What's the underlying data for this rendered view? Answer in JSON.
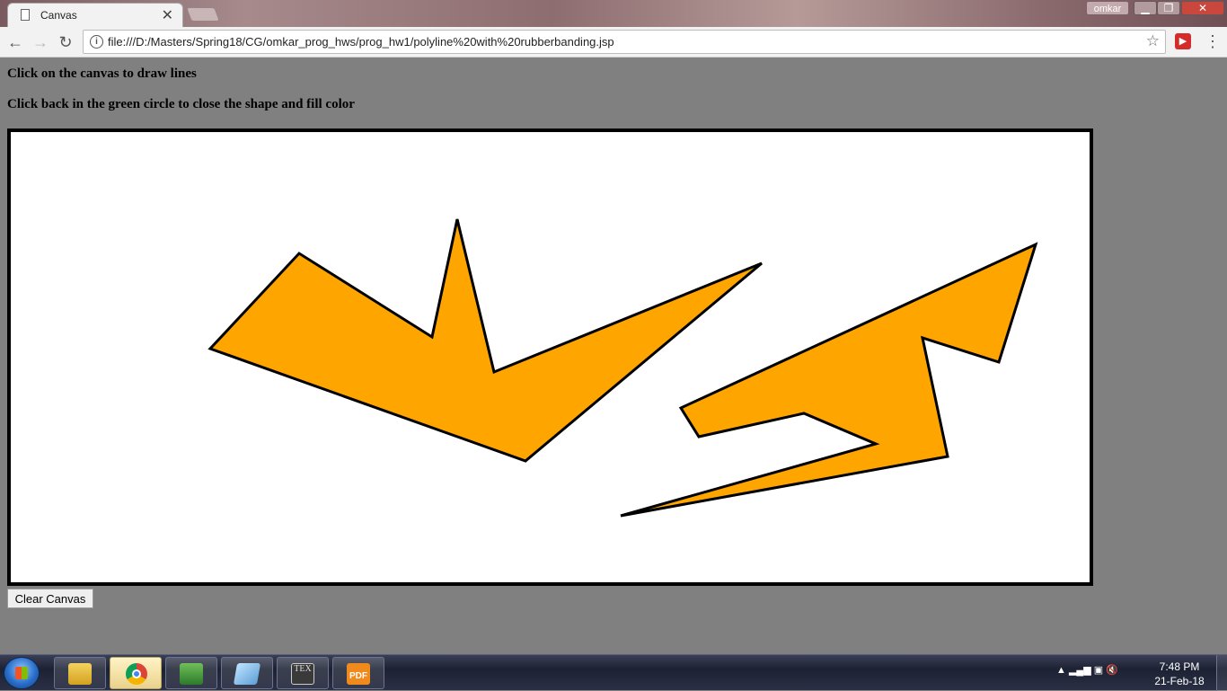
{
  "tab": {
    "title": "Canvas",
    "close_glyph": "✕"
  },
  "window": {
    "user": "omkar",
    "min": "▁",
    "max": "❐",
    "close": "✕"
  },
  "toolbar": {
    "back": "←",
    "forward": "→",
    "reload": "↻",
    "url": "file:///D:/Masters/Spring18/CG/omkar_prog_hws/prog_hw1/polyline%20with%20rubberbanding.jsp",
    "info": "i",
    "star": "☆",
    "menu": "⋮",
    "ext": "▶"
  },
  "page": {
    "instruction1": "Click on the canvas to draw lines",
    "instruction2": "Click back in the green circle to close the shape and fill color",
    "clear_button": "Clear Canvas"
  },
  "canvas": {
    "fill_color": "#ffa500",
    "stroke_color": "#000000",
    "background": "#ffffff"
  },
  "taskbar": {
    "apps": [
      {
        "name": "Windows Explorer",
        "icon": "folder-icon"
      },
      {
        "name": "Google Chrome",
        "icon": "chrome-icon"
      },
      {
        "name": "Notepad++",
        "icon": "editor-icon"
      },
      {
        "name": "Notes",
        "icon": "note-icon"
      },
      {
        "name": "TeXmaker",
        "icon": "tex-icon",
        "glyph": "TEX"
      },
      {
        "name": "PDF",
        "icon": "pdf-icon",
        "glyph": "PDF"
      }
    ],
    "time": "7:48 PM",
    "date": "21-Feb-18",
    "tray": "▲  ▂▄▆  ▣  🔇"
  }
}
